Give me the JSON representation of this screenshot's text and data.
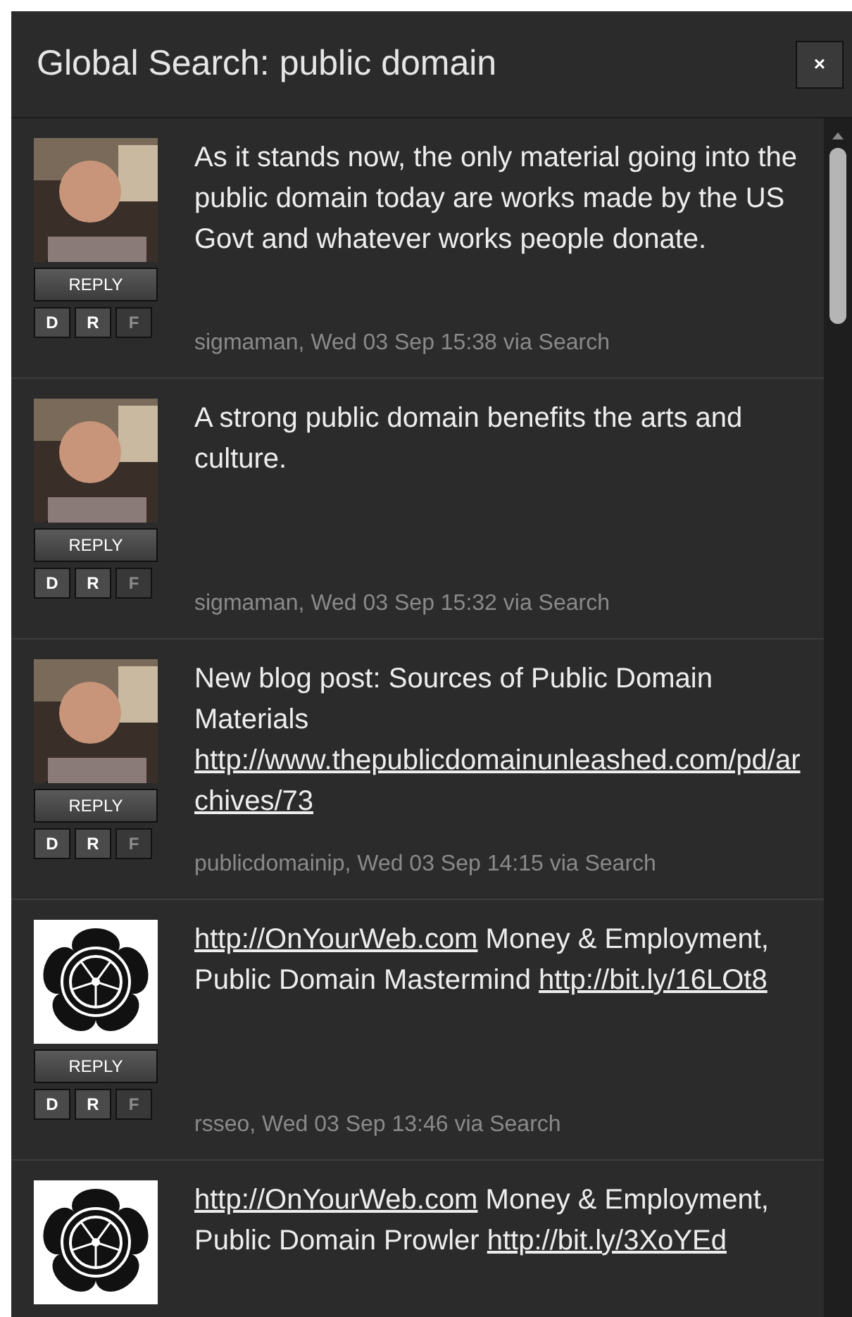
{
  "window": {
    "title": "Global Search: public domain",
    "close": "×"
  },
  "tweets": [
    {
      "reply": "REPLY",
      "actions": [
        {
          "label": "D",
          "disabled": false
        },
        {
          "label": "R",
          "disabled": false
        },
        {
          "label": "F",
          "disabled": true
        }
      ],
      "parts": [
        {
          "kind": "text",
          "text": "As it stands now, the only material going into the public domain today are works made by the US Govt and whatever works people donate."
        }
      ],
      "meta": "sigmaman, Wed 03 Sep 15:38 via Search"
    },
    {
      "reply": "REPLY",
      "actions": [
        {
          "label": "D",
          "disabled": false
        },
        {
          "label": "R",
          "disabled": false
        },
        {
          "label": "F",
          "disabled": true
        }
      ],
      "parts": [
        {
          "kind": "text",
          "text": "A strong public domain benefits the arts and culture."
        }
      ],
      "meta": "sigmaman, Wed 03 Sep 15:32 via Search"
    },
    {
      "reply": "REPLY",
      "actions": [
        {
          "label": "D",
          "disabled": false
        },
        {
          "label": "R",
          "disabled": false
        },
        {
          "label": "F",
          "disabled": true
        }
      ],
      "parts": [
        {
          "kind": "text",
          "text": "New blog post: Sources of Public Domain Materials"
        },
        {
          "kind": "link",
          "text": "http://www.thepublicdomainunleashed.com/pd/archives/73"
        }
      ],
      "meta": "publicdomainip, Wed 03 Sep 14:15 via Search"
    },
    {
      "kind": "crest",
      "reply": "REPLY",
      "actions": [
        {
          "label": "D",
          "disabled": false
        },
        {
          "label": "R",
          "disabled": false
        },
        {
          "label": "F",
          "disabled": true
        }
      ],
      "parts": [
        {
          "kind": "link",
          "text": "http://OnYourWeb.com"
        },
        {
          "kind": "text",
          "text": "Money & Employment, Public Domain Mastermind"
        },
        {
          "kind": "link",
          "text": "http://bit.ly/16LOt8"
        }
      ],
      "meta": "rsseo, Wed 03 Sep 13:46 via Search"
    },
    {
      "kind": "crest",
      "parts": [
        {
          "kind": "link",
          "text": "http://OnYourWeb.com"
        },
        {
          "kind": "text",
          "text": "Money & Employment, Public Domain Prowler"
        },
        {
          "kind": "link",
          "text": "http://bit.ly/3XoYEd"
        }
      ]
    }
  ]
}
